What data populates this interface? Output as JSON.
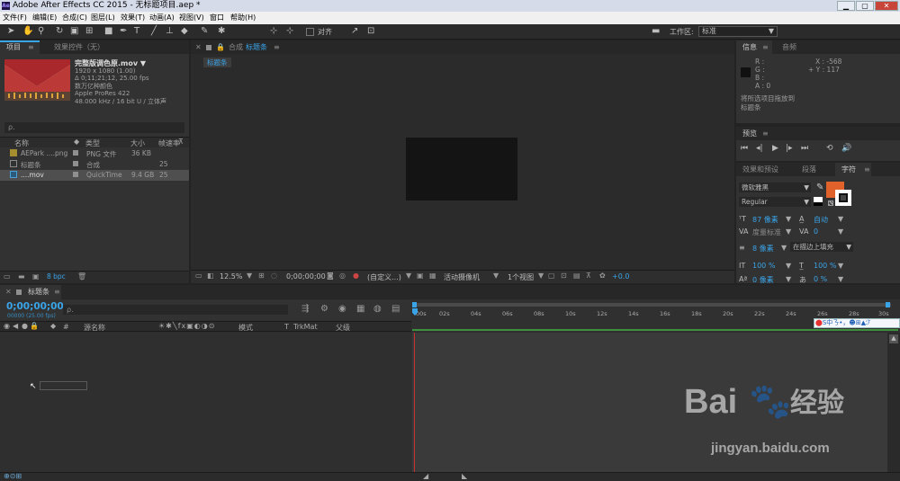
{
  "window": {
    "title": "Adobe After Effects CC 2015 - 无标题项目.aep *",
    "ae_icon": "Ae",
    "min": "▁",
    "max": "▢",
    "close": "✕"
  },
  "menu": [
    "文件(F)",
    "编辑(E)",
    "合成(C)",
    "图层(L)",
    "效果(T)",
    "动画(A)",
    "视图(V)",
    "窗口",
    "帮助(H)"
  ],
  "toolbar": {
    "align_label": "对齐",
    "workspace_label": "工作区:",
    "workspace_value": "标准"
  },
  "project": {
    "tab_project": "项目",
    "tab_effects": "效果控件（无）",
    "item_name": "完整版调色原.mov ▼",
    "info_lines": [
      "1920 x 1080 (1.00)",
      "Δ 0;11;21;12, 25.00 fps",
      "数万亿种颜色",
      "Apple ProRes 422",
      "48.000 kHz / 16 bit U / 立体声"
    ],
    "search_placeholder": "ρ.",
    "cols": {
      "name": "名称",
      "type": "类型",
      "size": "大小",
      "fps": "帧速率"
    },
    "rows": [
      {
        "name": "AEPark ....png",
        "type": "PNG 文件",
        "size": "36 KB",
        "fps": ""
      },
      {
        "name": "标题条",
        "type": "合成",
        "size": "",
        "fps": "25"
      },
      {
        "name": "....mov",
        "type": "QuickTime",
        "size": "9.4 GB",
        "fps": "25"
      }
    ],
    "bpc": "8 bpc"
  },
  "comp": {
    "tab_prefix": "合成",
    "tab_name": "标题条",
    "chip": "标题条",
    "zoom": "12.5%",
    "time": "0;00;00;00",
    "res": "(自定义...)",
    "camera": "活动摄像机",
    "views": "1个视图",
    "offset": "+0.0"
  },
  "info": {
    "tab_info": "信息",
    "tab_audio": "音频",
    "r": "R :",
    "g": "G :",
    "b": "B :",
    "a": "A : 0",
    "x": "X : -568",
    "y": "+ Y : 117",
    "msg1": "将所选项目拖放到",
    "msg2": "标题条"
  },
  "preview": {
    "tab": "预览"
  },
  "tabs2": {
    "effects": "效果和预设",
    "para": "段落",
    "char": "字符"
  },
  "character": {
    "font": "微软雅黑",
    "style": "Regular",
    "size": "87 像素",
    "leading": "自动",
    "tracking_label": "度量标准",
    "tracking": "0",
    "stroke": "8 像素",
    "stroke_mode": "在描边上填充",
    "vscale": "100 %",
    "hscale": "100 %",
    "baseline": "0 像素",
    "tsume": "0 %"
  },
  "timeline": {
    "tab": "标题条",
    "time": "0;00;00;00",
    "fps": "00000 (25.00 fps)",
    "search_placeholder": "ρ.",
    "layer_name_col": "源名称",
    "mode_col": "模式",
    "t_col": "T",
    "trkmat_col": "TrkMat",
    "parent_col": "父级",
    "ruler": [
      "00s",
      "02s",
      "04s",
      "06s",
      "08s",
      "10s",
      "12s",
      "14s",
      "16s",
      "18s",
      "20s",
      "22s",
      "24s",
      "26s",
      "28s",
      "30s"
    ],
    "ime": "S中ㄋ•，☻⊞▲ℱ"
  },
  "watermark": {
    "brand": "Bai",
    "brand2": "经验",
    "url": "jingyan.baidu.com"
  },
  "colors": {
    "accent": "#3aa4e8",
    "orange": "#e0622a",
    "green": "#3e8f3e",
    "playhead": "#c8322e"
  }
}
